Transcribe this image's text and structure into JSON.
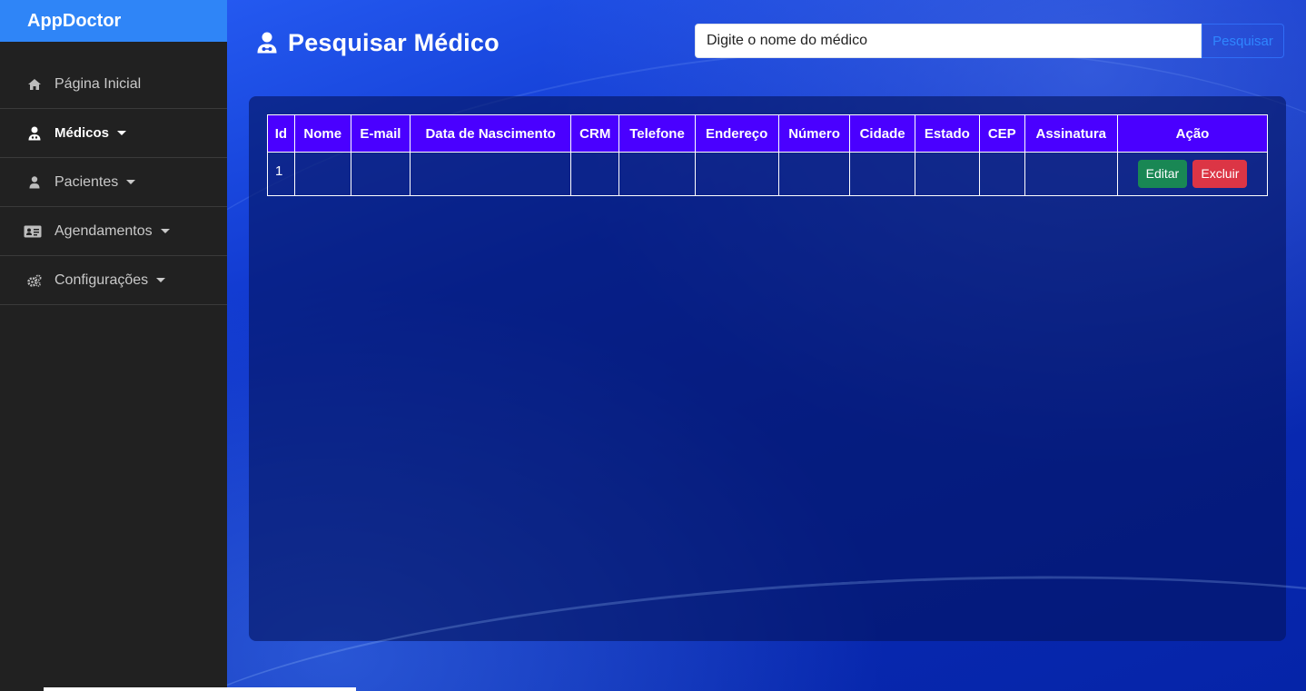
{
  "brand": {
    "name": "AppDoctor"
  },
  "sidebar": {
    "items": [
      {
        "label": "Página Inicial",
        "icon": "home-icon",
        "active": false,
        "dropdown": false
      },
      {
        "label": "Médicos",
        "icon": "doctor-icon",
        "active": true,
        "dropdown": true
      },
      {
        "label": "Pacientes",
        "icon": "user-icon",
        "active": false,
        "dropdown": true
      },
      {
        "label": "Agendamentos",
        "icon": "id-card-icon",
        "active": false,
        "dropdown": true
      },
      {
        "label": "Configurações",
        "icon": "gears-icon",
        "active": false,
        "dropdown": true
      }
    ]
  },
  "header": {
    "title": "Pesquisar Médico",
    "icon": "doctor-icon"
  },
  "search": {
    "value": "Digite o nome do médico",
    "button_label": "Pesquisar"
  },
  "table": {
    "columns": [
      "Id",
      "Nome",
      "E-mail",
      "Data de Nascimento",
      "CRM",
      "Telefone",
      "Endereço",
      "Número",
      "Cidade",
      "Estado",
      "CEP",
      "Assinatura",
      "Ação"
    ],
    "rows": [
      {
        "id": "1",
        "nome": "",
        "email": "",
        "data_nascimento": "",
        "crm": "",
        "telefone": "",
        "endereco": "",
        "numero": "",
        "cidade": "",
        "estado": "",
        "cep": "",
        "assinatura": "",
        "edit_label": "Editar",
        "delete_label": "Excluir"
      }
    ]
  },
  "colors": {
    "sidebar_bg": "#212121",
    "brand_bg": "#2f85f7",
    "table_header_bg": "#4a00ff",
    "edit_button": "#198754",
    "delete_button": "#dc3545"
  }
}
